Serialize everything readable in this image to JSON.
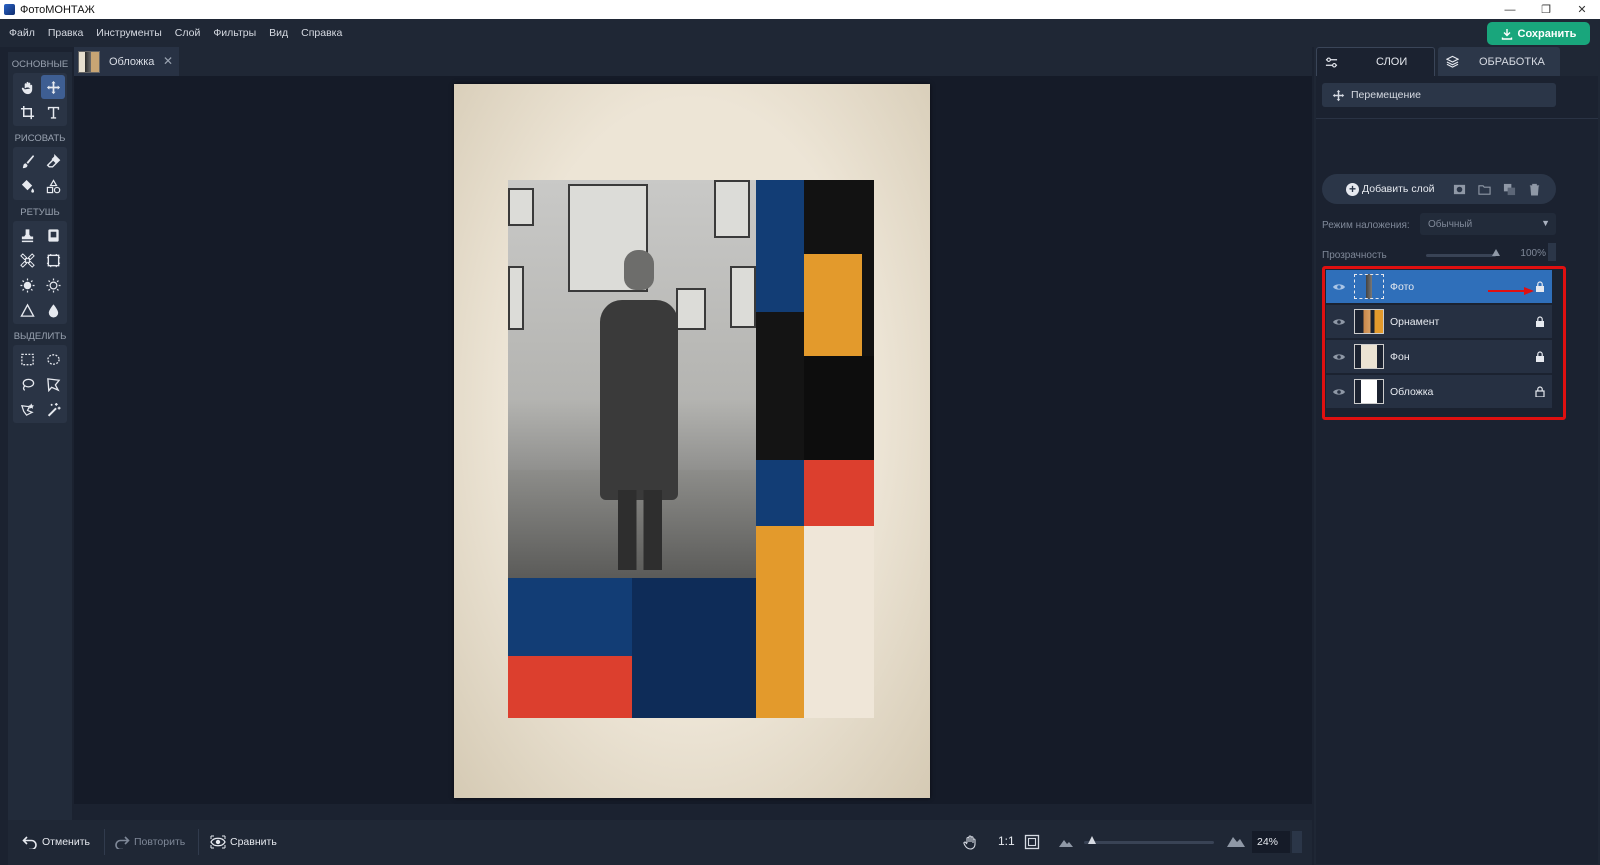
{
  "window": {
    "title": "ФотоМОНТАЖ",
    "controls": {
      "minimize": "—",
      "restore": "❐",
      "close": "✕"
    }
  },
  "menu": [
    "Файл",
    "Правка",
    "Инструменты",
    "Слой",
    "Фильтры",
    "Вид",
    "Справка"
  ],
  "save_button": {
    "label": "Сохранить"
  },
  "toolbar": {
    "groups": [
      {
        "title": "ОСНОВНЫЕ",
        "tools": [
          "hand-icon",
          "move-icon",
          "crop-icon",
          "text-icon"
        ]
      },
      {
        "title": "РИСОВАТЬ",
        "tools": [
          "brush-icon",
          "eraser-icon",
          "fill-icon",
          "shapes-icon"
        ]
      },
      {
        "title": "РЕТУШЬ",
        "tools": [
          "stamp-icon",
          "patch-icon",
          "healing-icon",
          "frame-icon",
          "dodge-icon",
          "burn-icon",
          "sharpen-icon",
          "blur-icon"
        ]
      },
      {
        "title": "ВЫДЕЛИТЬ",
        "tools": [
          "rect-select-icon",
          "ellipse-select-icon",
          "lasso-icon",
          "polygon-lasso-icon",
          "magic-lasso-icon",
          "magic-wand-icon"
        ]
      }
    ]
  },
  "document_tab": {
    "label": "Обложка",
    "close": "✕"
  },
  "canvas": {
    "colors": {
      "blue": "#123d75",
      "navy": "#0e2c58",
      "black": "#0d0d0d",
      "orange": "#e39a2c",
      "red": "#dc3f2e",
      "cream": "#efe6d8",
      "paper": "#ebe3d3"
    }
  },
  "right_panel": {
    "tabs": [
      {
        "label": "СЛОИ",
        "icon": "sliders-icon",
        "active": true
      },
      {
        "label": "ОБРАБОТКА",
        "icon": "layers-icon",
        "active": false
      }
    ],
    "move_tool": {
      "label": "Перемещение"
    },
    "add_layer": {
      "label": "Добавить слой"
    },
    "blend_mode": {
      "label": "Режим наложения:",
      "value": "Обычный"
    },
    "opacity": {
      "label": "Прозрачность",
      "value": "100%",
      "fraction": 1.0
    },
    "layers": [
      {
        "name": "Фото",
        "selected": true,
        "locked": true
      },
      {
        "name": "Орнамент",
        "selected": false,
        "locked": true
      },
      {
        "name": "Фон",
        "selected": false,
        "locked": true
      },
      {
        "name": "Обложка",
        "selected": false,
        "locked": false
      }
    ],
    "highlight_color": "#e01010"
  },
  "bottom_bar": {
    "undo": "Отменить",
    "redo": "Повторить",
    "compare": "Сравнить",
    "actual_size": "1:1",
    "zoom": {
      "value": "24%",
      "fraction": 0.03
    }
  }
}
